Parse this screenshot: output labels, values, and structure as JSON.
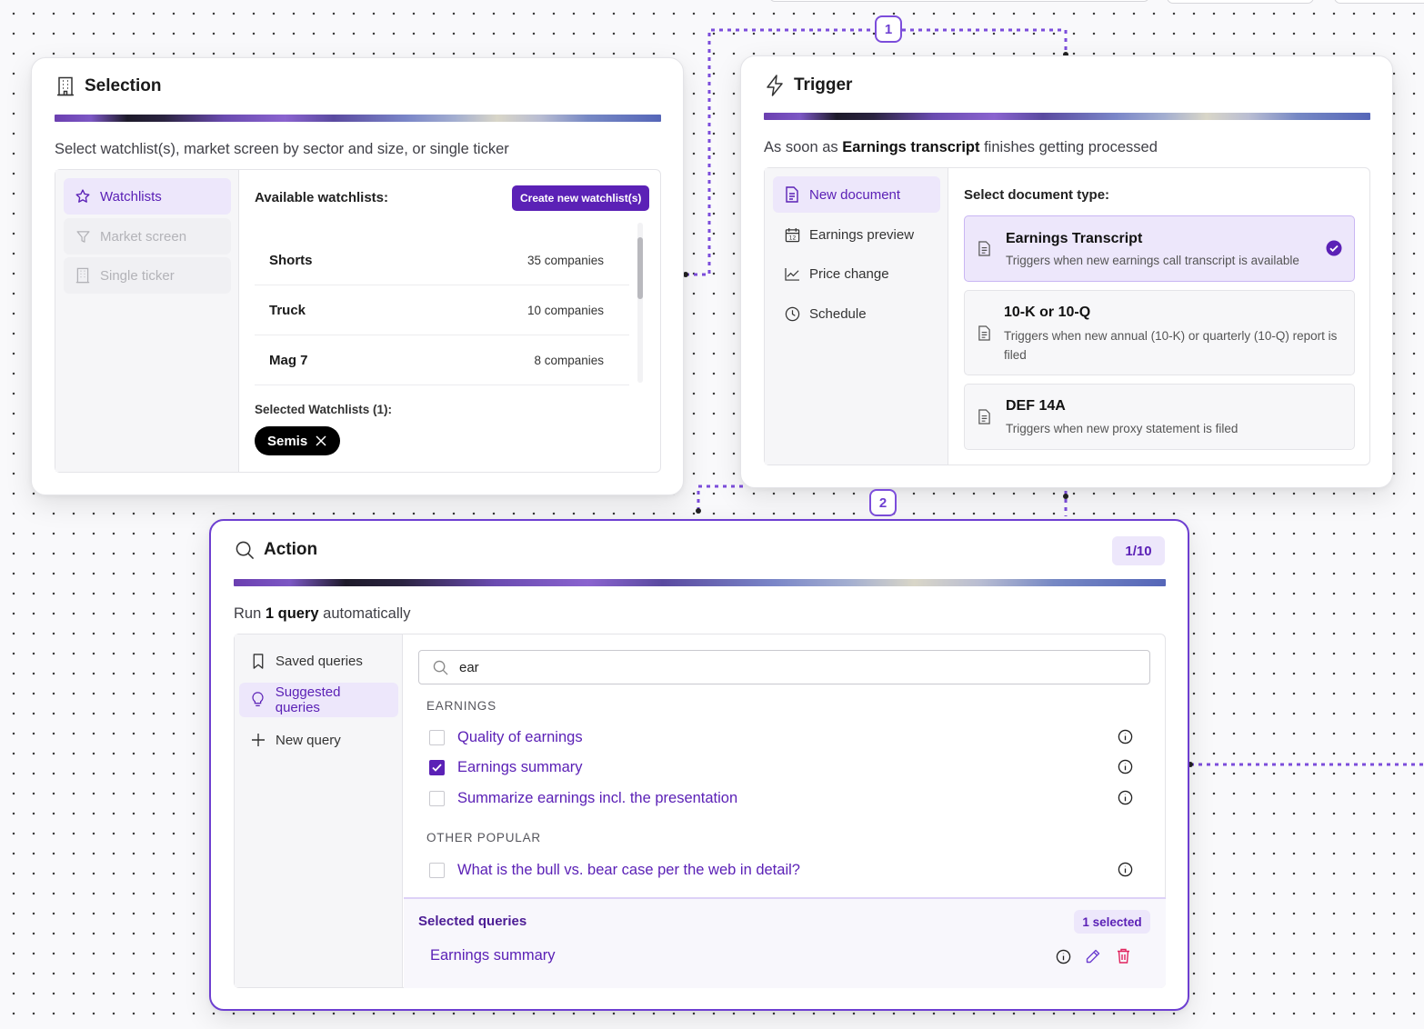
{
  "connectors": {
    "badge1": "1",
    "badge2": "2"
  },
  "selection": {
    "title": "Selection",
    "subtitle": "Select watchlist(s), market screen by sector and size, or single ticker",
    "nav": [
      {
        "label": "Watchlists",
        "icon": "star-icon",
        "state": "active"
      },
      {
        "label": "Market screen",
        "icon": "filter-icon",
        "state": "disabled"
      },
      {
        "label": "Single ticker",
        "icon": "building-icon",
        "state": "disabled"
      }
    ],
    "available_label": "Available watchlists:",
    "create_button": "Create new watchlist(s)",
    "watchlists": [
      {
        "name": "Shorts",
        "count": "35 companies"
      },
      {
        "name": "Truck",
        "count": "10 companies"
      },
      {
        "name": "Mag 7",
        "count": "8 companies"
      }
    ],
    "selected_label": "Selected Watchlists (1):",
    "selected_chips": [
      "Semis"
    ]
  },
  "trigger": {
    "title": "Trigger",
    "subtitle_pre": "As soon as ",
    "subtitle_bold": "Earnings transcript",
    "subtitle_post": " finishes getting processed",
    "nav": [
      {
        "label": "New document",
        "icon": "document-icon",
        "state": "active"
      },
      {
        "label": "Earnings preview",
        "icon": "calendar-icon",
        "state": "normal"
      },
      {
        "label": "Price change",
        "icon": "chart-line-icon",
        "state": "normal"
      },
      {
        "label": "Schedule",
        "icon": "clock-icon",
        "state": "normal"
      }
    ],
    "doc_type_label": "Select document type:",
    "doc_types": [
      {
        "title": "Earnings Transcript",
        "desc": "Triggers when new earnings call transcript is available",
        "selected": true
      },
      {
        "title": "10-K or 10-Q",
        "desc": "Triggers when new annual (10-K) or quarterly (10-Q) report is filed",
        "selected": false
      },
      {
        "title": "DEF 14A",
        "desc": "Triggers when new proxy statement is filed",
        "selected": false
      }
    ]
  },
  "action": {
    "title": "Action",
    "counter": "1/10",
    "subtitle_pre": "Run ",
    "subtitle_bold": "1 query",
    "subtitle_post": " automatically",
    "nav": [
      {
        "label": "Saved queries",
        "icon": "bookmark-icon",
        "state": "normal"
      },
      {
        "label": "Suggested queries",
        "icon": "lightbulb-icon",
        "state": "active"
      },
      {
        "label": "New query",
        "icon": "plus-icon",
        "state": "normal"
      }
    ],
    "search_value": "ear",
    "sections": [
      {
        "heading": "EARNINGS",
        "queries": [
          {
            "label": "Quality of earnings",
            "checked": false
          },
          {
            "label": "Earnings summary",
            "checked": true
          },
          {
            "label": "Summarize earnings incl. the presentation",
            "checked": false
          }
        ]
      },
      {
        "heading": "OTHER POPULAR",
        "queries": [
          {
            "label": "What is the bull vs. bear case per the web in detail?",
            "checked": false
          }
        ]
      }
    ],
    "selected_title": "Selected queries",
    "selected_count": "1 selected",
    "selected_items": [
      "Earnings summary"
    ]
  },
  "colors": {
    "accent": "#5b21b6",
    "accent_light": "#ede7fb",
    "connector": "#7c4ddb",
    "danger": "#e0245e"
  }
}
